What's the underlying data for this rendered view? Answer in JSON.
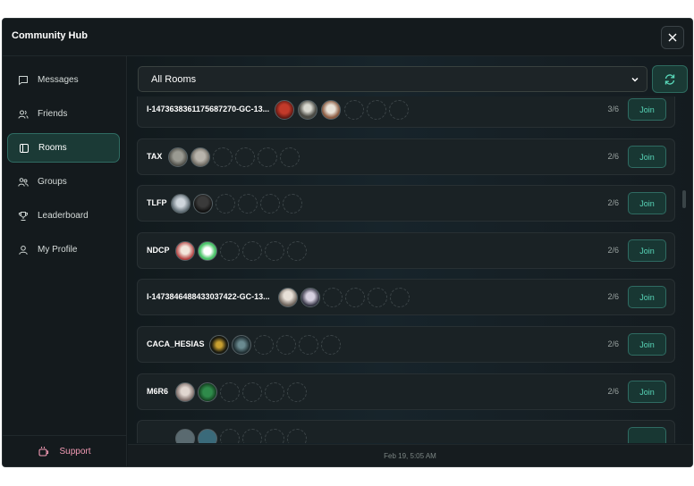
{
  "window": {
    "title": "Community Hub"
  },
  "sidebar": {
    "items": [
      {
        "label": "Messages",
        "icon": "message-square-icon"
      },
      {
        "label": "Friends",
        "icon": "users-icon"
      },
      {
        "label": "Rooms",
        "icon": "door-icon",
        "active": true
      },
      {
        "label": "Groups",
        "icon": "group-icon"
      },
      {
        "label": "Leaderboard",
        "icon": "trophy-icon"
      },
      {
        "label": "My Profile",
        "icon": "user-icon"
      }
    ],
    "support_label": "Support"
  },
  "main": {
    "filter": {
      "selected": "All Rooms"
    },
    "rooms": [
      {
        "name": "I-1473638361175687270-GC-13...",
        "count": "3/6",
        "join_label": "Join"
      },
      {
        "name": "TAX",
        "count": "2/6",
        "join_label": "Join"
      },
      {
        "name": "TLFP",
        "count": "2/6",
        "join_label": "Join"
      },
      {
        "name": "NDCP",
        "count": "2/6",
        "join_label": "Join"
      },
      {
        "name": "I-1473846488433037422-GC-13...",
        "count": "2/6",
        "join_label": "Join"
      },
      {
        "name": "CACA_HESIAS",
        "count": "2/6",
        "join_label": "Join"
      },
      {
        "name": "M6R6",
        "count": "2/6",
        "join_label": "Join"
      },
      {
        "name": "",
        "count": "",
        "join_label": ""
      }
    ],
    "footer": "Feb 19, 5:05 AM"
  },
  "colors": {
    "accent": "#58d6b8",
    "support": "#f29ab4",
    "background": "#12181b"
  }
}
